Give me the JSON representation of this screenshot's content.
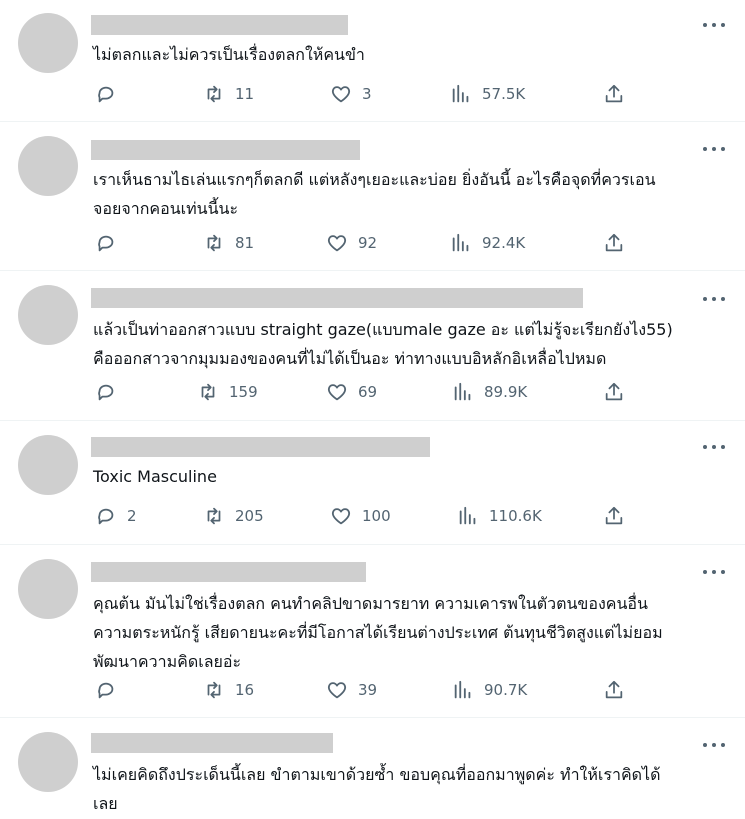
{
  "colors": {
    "icon": "#536471",
    "text": "#0f1419",
    "placeholder": "#cfcfcf",
    "divider": "#eff3f4"
  },
  "icons": {
    "reply": "reply-icon",
    "repost": "repost-icon",
    "like": "heart-icon",
    "views": "views-icon",
    "share": "share-icon",
    "more": "more-icon"
  },
  "posts": [
    {
      "text": "ไม่ตลกและไม่ควรเป็นเรื่องตลกให้คนขำ",
      "replies": "",
      "reposts": "11",
      "likes": "3",
      "views": "57.5K"
    },
    {
      "text": "เราเห็นธามไธเล่นแรกๆก็ตลกดี แต่หลังๆเยอะและบ่อย ยิ่งอันนี้ อะไรคือจุดที่ควรเอน\nจอยจากคอนเท่นนี้นะ",
      "replies": "",
      "reposts": "81",
      "likes": "92",
      "views": "92.4K"
    },
    {
      "text": "แล้วเป็นท่าออกสาวแบบ straight gaze(แบบmale gaze อะ แต่ไม่รู้จะเรียกยังไง55)\nคือออกสาวจากมุมมองของคนที่ไม่ได้เป็นอะ ท่าทางแบบอิหลักอิเหลื่อไปหมด",
      "replies": "",
      "reposts": "159",
      "likes": "69",
      "views": "89.9K"
    },
    {
      "text": "Toxic Masculine",
      "replies": "2",
      "reposts": "205",
      "likes": "100",
      "views": "110.6K"
    },
    {
      "text": "คุณต้น มันไม่ใช่เรื่องตลก คนทำคลิปขาดมารยาท ความเคารพในตัวตนของคนอื่น\nความตระหนักรู้ เสียดายนะคะที่มีโอกาสได้เรียนต่างประเทศ ต้นทุนชีวิตสูงแต่ไม่ยอม\nพัฒนาความคิดเลยอ่ะ",
      "replies": "",
      "reposts": "16",
      "likes": "39",
      "views": "90.7K"
    },
    {
      "text": "ไม่เคยคิดถึงประเด็นนี้เลย ขำตามเขาด้วยซ้ำ ขอบคุณที่ออกมาพูดค่ะ ทำให้เราคิดได้\nเลย"
    }
  ]
}
